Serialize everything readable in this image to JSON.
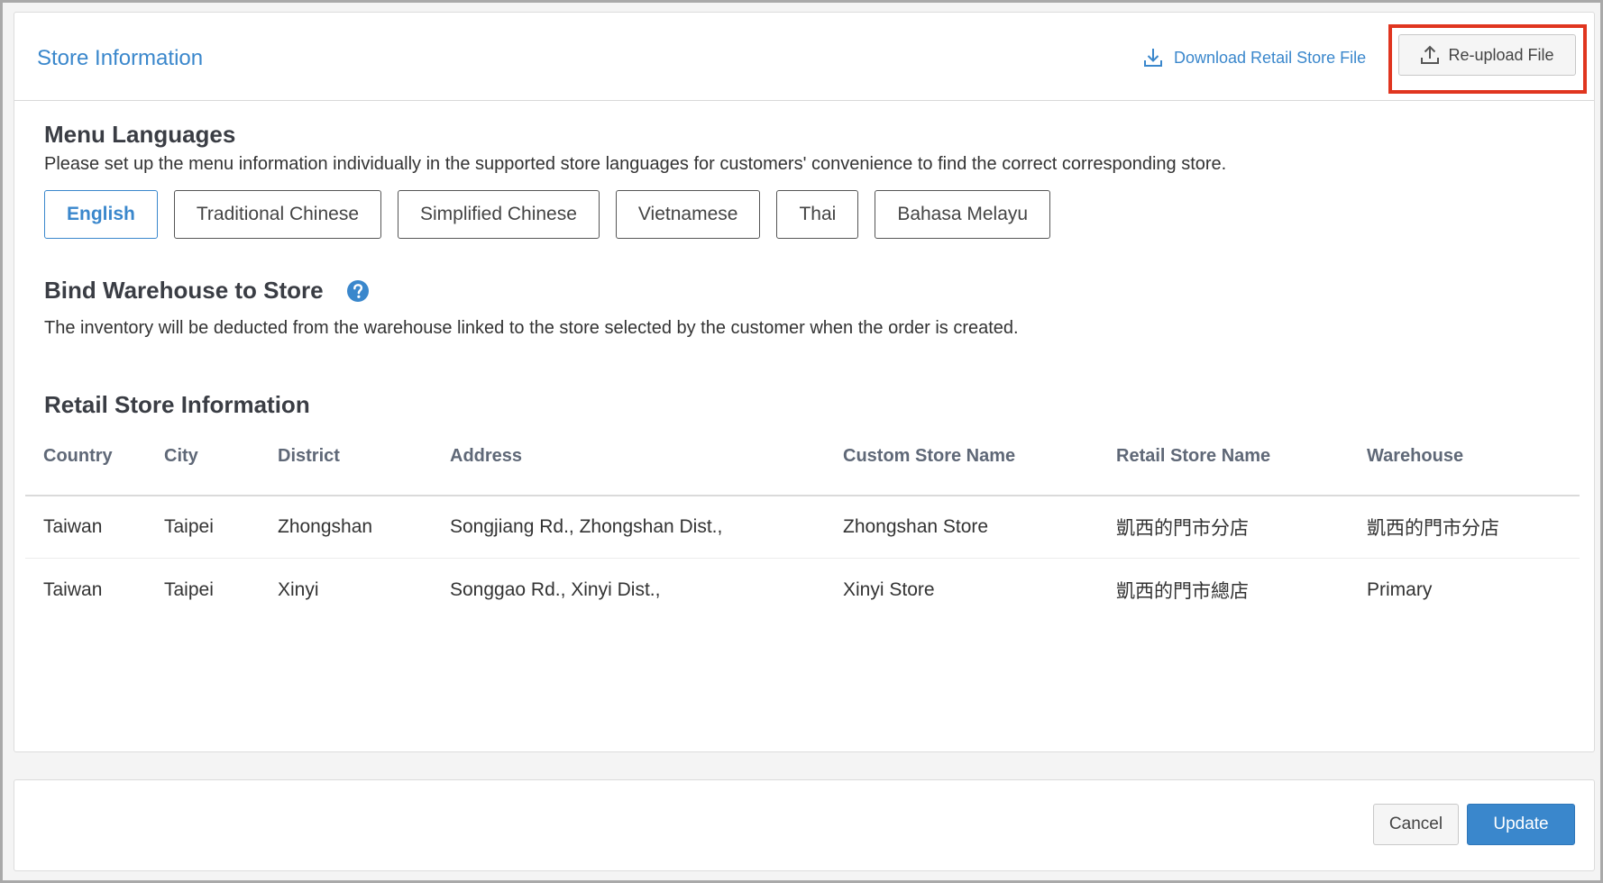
{
  "header": {
    "title": "Store Information",
    "download_label": "Download Retail Store File",
    "reupload_label": "Re-upload File"
  },
  "menu_languages": {
    "title": "Menu Languages",
    "description": "Please set up the menu information individually in the supported store languages for customers' convenience to find the correct corresponding store.",
    "languages": [
      "English",
      "Traditional Chinese",
      "Simplified Chinese",
      "Vietnamese",
      "Thai",
      "Bahasa Melayu"
    ],
    "selected": "English"
  },
  "bind_warehouse": {
    "title": "Bind Warehouse to Store",
    "description": "The inventory will be deducted from the warehouse linked to the store selected by the customer when the order is created."
  },
  "retail_store": {
    "title": "Retail Store Information",
    "columns": [
      "Country",
      "City",
      "District",
      "Address",
      "Custom Store Name",
      "Retail Store Name",
      "Warehouse"
    ],
    "rows": [
      [
        "Taiwan",
        "Taipei",
        "Zhongshan",
        "Songjiang Rd., Zhongshan Dist.,",
        "Zhongshan Store",
        "凱西的門市分店",
        "凱西的門市分店"
      ],
      [
        "Taiwan",
        "Taipei",
        "Xinyi",
        "Songgao Rd., Xinyi Dist.,",
        "Xinyi Store",
        "凱西的門市總店",
        "Primary"
      ]
    ]
  },
  "footer": {
    "cancel_label": "Cancel",
    "update_label": "Update"
  },
  "colors": {
    "accent": "#3a87cc",
    "highlight": "#e0351f"
  }
}
